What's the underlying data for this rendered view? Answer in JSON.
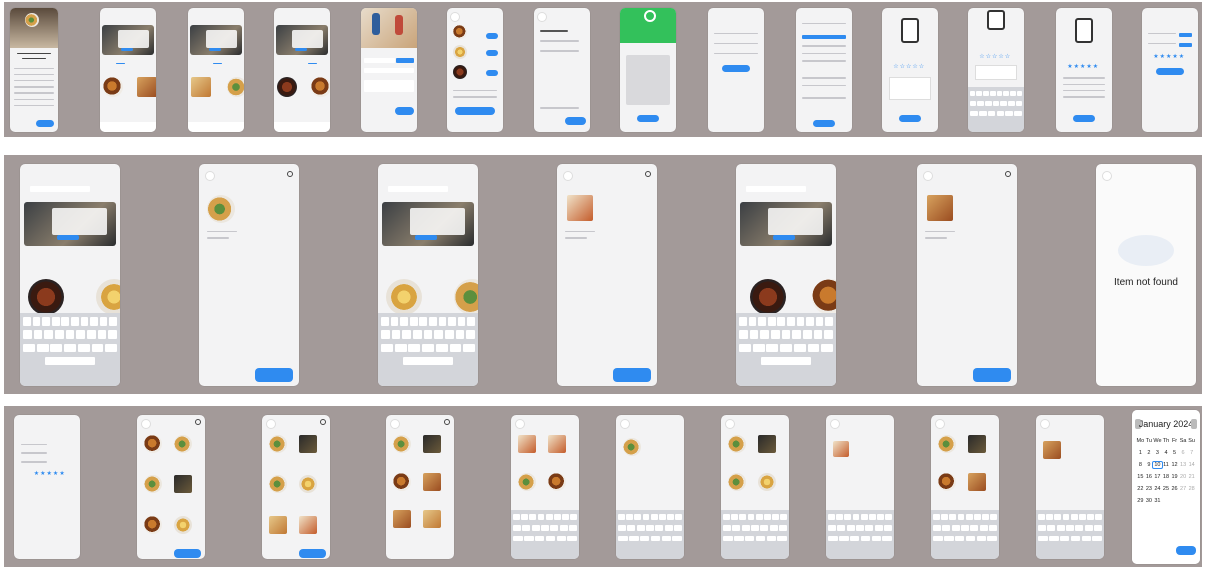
{
  "canvas": {
    "background": "#a39a99",
    "accent": "#2f8bf0",
    "success": "#33c15b"
  },
  "not_found": {
    "title": "Item not found",
    "subtitle": ""
  },
  "calendar": {
    "month": "January 2024",
    "weekdays": [
      "Mo",
      "Tu",
      "We",
      "Th",
      "Fr",
      "Sa",
      "Su"
    ],
    "days": [
      {
        "d": "1"
      },
      {
        "d": "2"
      },
      {
        "d": "3"
      },
      {
        "d": "4"
      },
      {
        "d": "5"
      },
      {
        "d": "6",
        "dim": true
      },
      {
        "d": "7",
        "dim": true
      },
      {
        "d": "8"
      },
      {
        "d": "9"
      },
      {
        "d": "10",
        "selected": true
      },
      {
        "d": "11"
      },
      {
        "d": "12"
      },
      {
        "d": "13",
        "dim": true
      },
      {
        "d": "14",
        "dim": true
      },
      {
        "d": "15"
      },
      {
        "d": "16"
      },
      {
        "d": "17"
      },
      {
        "d": "18"
      },
      {
        "d": "19"
      },
      {
        "d": "20",
        "dim": true
      },
      {
        "d": "21",
        "dim": true
      },
      {
        "d": "22"
      },
      {
        "d": "23"
      },
      {
        "d": "24"
      },
      {
        "d": "25"
      },
      {
        "d": "26"
      },
      {
        "d": "27",
        "dim": true
      },
      {
        "d": "28",
        "dim": true
      },
      {
        "d": "29"
      },
      {
        "d": "30"
      },
      {
        "d": "31"
      }
    ]
  },
  "icons": {
    "back": "chevron-left-icon",
    "search": "search-icon",
    "success": "checkmark-icon",
    "bag": "shopping-bag-icon"
  }
}
